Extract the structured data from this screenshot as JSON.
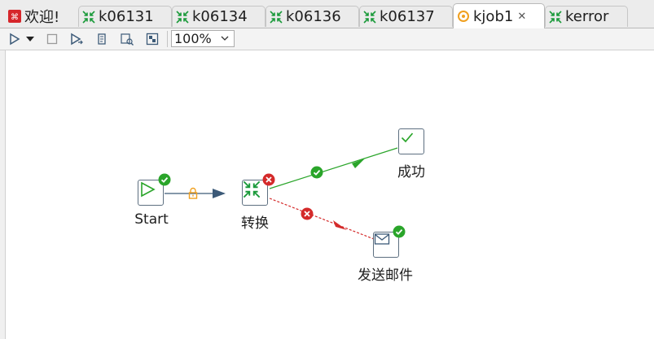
{
  "tabs": [
    {
      "label": "欢迎!",
      "icon": "welcome-icon",
      "active": false
    },
    {
      "label": "k06131",
      "icon": "transformation-icon",
      "active": false
    },
    {
      "label": "k06134",
      "icon": "transformation-icon",
      "active": false
    },
    {
      "label": "k06136",
      "icon": "transformation-icon",
      "active": false
    },
    {
      "label": "k06137",
      "icon": "transformation-icon",
      "active": false
    },
    {
      "label": "kjob1",
      "icon": "job-icon",
      "active": true
    },
    {
      "label": "kerror",
      "icon": "transformation-icon",
      "active": false
    }
  ],
  "toolbar": {
    "zoom": "100%",
    "buttons": [
      "run-icon",
      "run-options-icon",
      "stop-icon",
      "run-from-icon",
      "sql-icon",
      "impact-icon",
      "grid-icon"
    ]
  },
  "nodes": {
    "start": {
      "label": "Start",
      "icon": "start-icon",
      "status": "success"
    },
    "transform": {
      "label": "转换",
      "icon": "transformation-icon",
      "status": "error"
    },
    "success": {
      "label": "成功",
      "icon": "checkmark-icon"
    },
    "mail": {
      "label": "发送邮件",
      "icon": "mail-icon",
      "status": "success"
    }
  },
  "hops": [
    {
      "from": "start",
      "to": "transform",
      "type": "unconditional",
      "color": "#3c5a78"
    },
    {
      "from": "transform",
      "to": "success",
      "type": "on-success",
      "color": "#2aa52a"
    },
    {
      "from": "transform",
      "to": "mail",
      "type": "on-failure",
      "color": "#d42a2a"
    }
  ],
  "colors": {
    "success": "#2aa52a",
    "error": "#d42a2a",
    "lock": "#f0a020",
    "node_border": "#5d6f80"
  }
}
